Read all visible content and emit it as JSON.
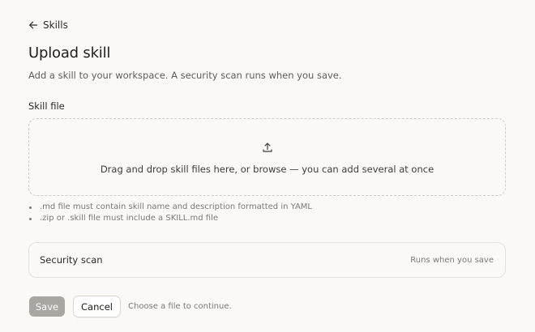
{
  "nav": {
    "back_label": "Skills",
    "back_icon": "arrow-left-icon"
  },
  "header": {
    "title": "Upload skill",
    "subtitle": "Add a skill to your workspace. A security scan runs when you save."
  },
  "skill_file": {
    "label": "Skill file",
    "dropzone_icon": "upload-icon",
    "dropzone_text": "Drag and drop skill files here, or browse — you can add several at once",
    "hints": [
      ".md file must contain skill name and description formatted in YAML",
      ".zip or .skill file must include a SKILL.md file"
    ]
  },
  "security_scan": {
    "title": "Security scan",
    "status": "Runs when you save"
  },
  "actions": {
    "save_label": "Save",
    "cancel_label": "Cancel",
    "hint": "Choose a file to continue."
  },
  "colors": {
    "background": "#faf9f5",
    "save_disabled": "#a8a7a1",
    "muted_text": "#7a7974"
  }
}
